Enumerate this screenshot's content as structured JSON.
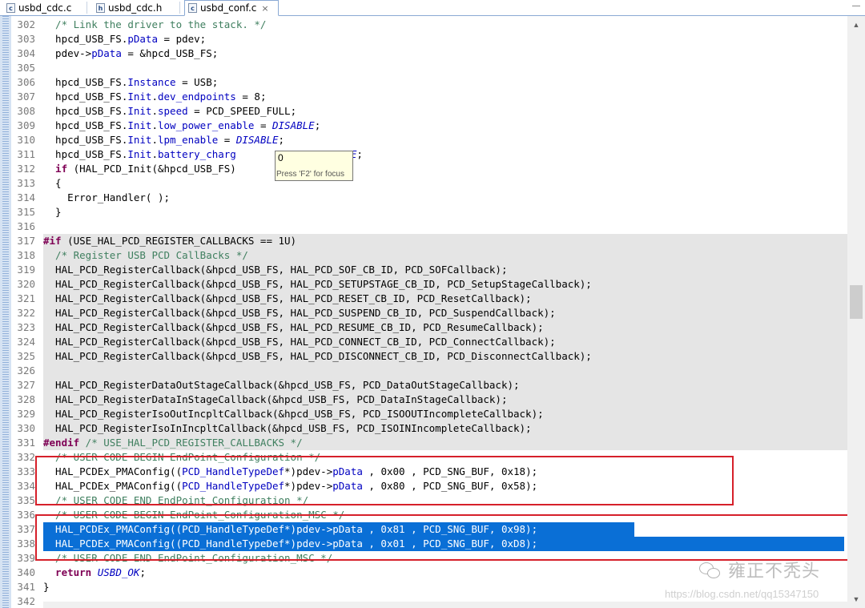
{
  "tabs": [
    {
      "icon": "c",
      "label": "usbd_cdc.c",
      "active": false
    },
    {
      "icon": "h",
      "label": "usbd_cdc.h",
      "active": false
    },
    {
      "icon": "c",
      "label": "usbd_conf.c",
      "active": true,
      "close": "×"
    }
  ],
  "tab_minimize": "—",
  "tooltip": {
    "value": "0",
    "hint": "Press 'F2' for focus"
  },
  "scroll": {
    "up": "▲",
    "down": "▼"
  },
  "lines": [
    {
      "n": "302",
      "bg": "",
      "parts": [
        [
          "c-com",
          "  /* Link the driver to the stack. */"
        ]
      ]
    },
    {
      "n": "303",
      "bg": "",
      "parts": [
        [
          "",
          "  hpcd_USB_FS."
        ],
        [
          "c-fld",
          "pData"
        ],
        [
          "",
          " = pdev;"
        ]
      ]
    },
    {
      "n": "304",
      "bg": "",
      "parts": [
        [
          "",
          "  pdev->"
        ],
        [
          "c-fld",
          "pData"
        ],
        [
          "",
          " = &hpcd_USB_FS;"
        ]
      ]
    },
    {
      "n": "305",
      "bg": "",
      "parts": [
        [
          "",
          ""
        ]
      ]
    },
    {
      "n": "306",
      "bg": "",
      "parts": [
        [
          "",
          "  hpcd_USB_FS."
        ],
        [
          "c-fld",
          "Instance"
        ],
        [
          "",
          " = USB;"
        ]
      ]
    },
    {
      "n": "307",
      "bg": "",
      "parts": [
        [
          "",
          "  hpcd_USB_FS."
        ],
        [
          "c-fld",
          "Init"
        ],
        [
          "",
          "."
        ],
        [
          "c-fld",
          "dev_endpoints"
        ],
        [
          "",
          " = 8;"
        ]
      ]
    },
    {
      "n": "308",
      "bg": "",
      "parts": [
        [
          "",
          "  hpcd_USB_FS."
        ],
        [
          "c-fld",
          "Init"
        ],
        [
          "",
          "."
        ],
        [
          "c-fld",
          "speed"
        ],
        [
          "",
          " = PCD_SPEED_FULL;"
        ]
      ]
    },
    {
      "n": "309",
      "bg": "",
      "parts": [
        [
          "",
          "  hpcd_USB_FS."
        ],
        [
          "c-fld",
          "Init"
        ],
        [
          "",
          "."
        ],
        [
          "c-fld",
          "low_power_enable"
        ],
        [
          "",
          " = "
        ],
        [
          "c-mac",
          "DISABLE"
        ],
        [
          "",
          ";"
        ]
      ]
    },
    {
      "n": "310",
      "bg": "",
      "parts": [
        [
          "",
          "  hpcd_USB_FS."
        ],
        [
          "c-fld",
          "Init"
        ],
        [
          "",
          "."
        ],
        [
          "c-fld",
          "lpm_enable"
        ],
        [
          "",
          " = "
        ],
        [
          "c-mac",
          "DISABLE"
        ],
        [
          "",
          ";"
        ]
      ]
    },
    {
      "n": "311",
      "bg": "",
      "parts": [
        [
          "",
          "  hpcd_USB_FS."
        ],
        [
          "c-fld",
          "Init"
        ],
        [
          "",
          "."
        ],
        [
          "c-fld",
          "battery_charg"
        ],
        [
          "",
          "           = "
        ],
        [
          "c-mac",
          "DISABLE"
        ],
        [
          "",
          ";"
        ]
      ]
    },
    {
      "n": "312",
      "bg": "",
      "parts": [
        [
          "c-kw",
          "  if"
        ],
        [
          "",
          " (HAL_PCD_Init(&hpcd_USB_FS)"
        ]
      ]
    },
    {
      "n": "313",
      "bg": "",
      "parts": [
        [
          "",
          "  {"
        ]
      ]
    },
    {
      "n": "314",
      "bg": "",
      "parts": [
        [
          "",
          "    Error_Handler( );"
        ]
      ]
    },
    {
      "n": "315",
      "bg": "",
      "parts": [
        [
          "",
          "  }"
        ]
      ]
    },
    {
      "n": "316",
      "bg": "",
      "parts": [
        [
          "",
          ""
        ]
      ]
    },
    {
      "n": "317",
      "bg": "gray",
      "parts": [
        [
          "c-kw",
          "#if"
        ],
        [
          "",
          " (USE_HAL_PCD_REGISTER_CALLBACKS == 1U)"
        ]
      ]
    },
    {
      "n": "318",
      "bg": "gray",
      "parts": [
        [
          "c-com",
          "  /* Register USB PCD CallBacks */"
        ]
      ]
    },
    {
      "n": "319",
      "bg": "gray",
      "parts": [
        [
          "",
          "  HAL_PCD_RegisterCallback(&hpcd_USB_FS, HAL_PCD_SOF_CB_ID, PCD_SOFCallback);"
        ]
      ]
    },
    {
      "n": "320",
      "bg": "gray",
      "parts": [
        [
          "",
          "  HAL_PCD_RegisterCallback(&hpcd_USB_FS, HAL_PCD_SETUPSTAGE_CB_ID, PCD_SetupStageCallback);"
        ]
      ]
    },
    {
      "n": "321",
      "bg": "gray",
      "parts": [
        [
          "",
          "  HAL_PCD_RegisterCallback(&hpcd_USB_FS, HAL_PCD_RESET_CB_ID, PCD_ResetCallback);"
        ]
      ]
    },
    {
      "n": "322",
      "bg": "gray",
      "parts": [
        [
          "",
          "  HAL_PCD_RegisterCallback(&hpcd_USB_FS, HAL_PCD_SUSPEND_CB_ID, PCD_SuspendCallback);"
        ]
      ]
    },
    {
      "n": "323",
      "bg": "gray",
      "parts": [
        [
          "",
          "  HAL_PCD_RegisterCallback(&hpcd_USB_FS, HAL_PCD_RESUME_CB_ID, PCD_ResumeCallback);"
        ]
      ]
    },
    {
      "n": "324",
      "bg": "gray",
      "parts": [
        [
          "",
          "  HAL_PCD_RegisterCallback(&hpcd_USB_FS, HAL_PCD_CONNECT_CB_ID, PCD_ConnectCallback);"
        ]
      ]
    },
    {
      "n": "325",
      "bg": "gray",
      "parts": [
        [
          "",
          "  HAL_PCD_RegisterCallback(&hpcd_USB_FS, HAL_PCD_DISCONNECT_CB_ID, PCD_DisconnectCallback);"
        ]
      ]
    },
    {
      "n": "326",
      "bg": "gray",
      "parts": [
        [
          "",
          ""
        ]
      ]
    },
    {
      "n": "327",
      "bg": "gray",
      "parts": [
        [
          "",
          "  HAL_PCD_RegisterDataOutStageCallback(&hpcd_USB_FS, PCD_DataOutStageCallback);"
        ]
      ]
    },
    {
      "n": "328",
      "bg": "gray",
      "parts": [
        [
          "",
          "  HAL_PCD_RegisterDataInStageCallback(&hpcd_USB_FS, PCD_DataInStageCallback);"
        ]
      ]
    },
    {
      "n": "329",
      "bg": "gray",
      "parts": [
        [
          "",
          "  HAL_PCD_RegisterIsoOutIncpltCallback(&hpcd_USB_FS, PCD_ISOOUTIncompleteCallback);"
        ]
      ]
    },
    {
      "n": "330",
      "bg": "gray",
      "parts": [
        [
          "",
          "  HAL_PCD_RegisterIsoInIncpltCallback(&hpcd_USB_FS, PCD_ISOINIncompleteCallback);"
        ]
      ]
    },
    {
      "n": "331",
      "bg": "gray",
      "parts": [
        [
          "c-kw",
          "#endif"
        ],
        [
          "c-com",
          " /* USE_HAL_PCD_REGISTER_CALLBACKS */"
        ]
      ]
    },
    {
      "n": "332",
      "bg": "",
      "parts": [
        [
          "c-com",
          "  /* USER CODE BEGIN EndPoint_Configuration */"
        ]
      ]
    },
    {
      "n": "333",
      "bg": "",
      "parts": [
        [
          "",
          "  HAL_PCDEx_PMAConfig(("
        ],
        [
          "c-fld",
          "PCD_HandleTypeDef"
        ],
        [
          "",
          "*)pdev->"
        ],
        [
          "c-fld",
          "pData"
        ],
        [
          "",
          " , 0x00 , PCD_SNG_BUF, 0x18);"
        ]
      ]
    },
    {
      "n": "334",
      "bg": "",
      "parts": [
        [
          "",
          "  HAL_PCDEx_PMAConfig(("
        ],
        [
          "c-fld",
          "PCD_HandleTypeDef"
        ],
        [
          "",
          "*)pdev->"
        ],
        [
          "c-fld",
          "pData"
        ],
        [
          "",
          " , 0x80 , PCD_SNG_BUF, 0x58);"
        ]
      ]
    },
    {
      "n": "335",
      "bg": "",
      "parts": [
        [
          "c-com",
          "  /* USER CODE END EndPoint_Configuration */"
        ]
      ]
    },
    {
      "n": "336",
      "bg": "",
      "parts": [
        [
          "c-com",
          "  /* USER CODE BEGIN EndPoint_Configuration_MSC */"
        ]
      ]
    },
    {
      "n": "337",
      "bg": "sel",
      "parts": [
        [
          "",
          "  HAL_PCDEx_PMAConfig((PCD_HandleTypeDef*)pdev->pData , 0x81 , PCD_SNG_BUF, 0x98);"
        ]
      ]
    },
    {
      "n": "338",
      "bg": "sel",
      "parts": [
        [
          "",
          "  HAL_PCDEx_PMAConfig((PCD_HandleTypeDef*)pdev->pData , 0x01 , PCD_SNG_BUF, 0xD8);"
        ]
      ]
    },
    {
      "n": "339",
      "bg": "",
      "parts": [
        [
          "c-com",
          "  /* USER CODE END EndPoint_Configuration_MSC */"
        ]
      ]
    },
    {
      "n": "340",
      "bg": "",
      "parts": [
        [
          "c-kw",
          "  return"
        ],
        [
          "",
          " "
        ],
        [
          "c-mac",
          "USBD_OK"
        ],
        [
          "",
          ";"
        ]
      ]
    },
    {
      "n": "341",
      "bg": "",
      "parts": [
        [
          "",
          "}"
        ]
      ]
    },
    {
      "n": "342",
      "bg": "",
      "parts": [
        [
          "",
          ""
        ]
      ]
    }
  ],
  "watermark": {
    "name": "雍正不秃头",
    "url": "https://blog.csdn.net/qq15347150"
  }
}
